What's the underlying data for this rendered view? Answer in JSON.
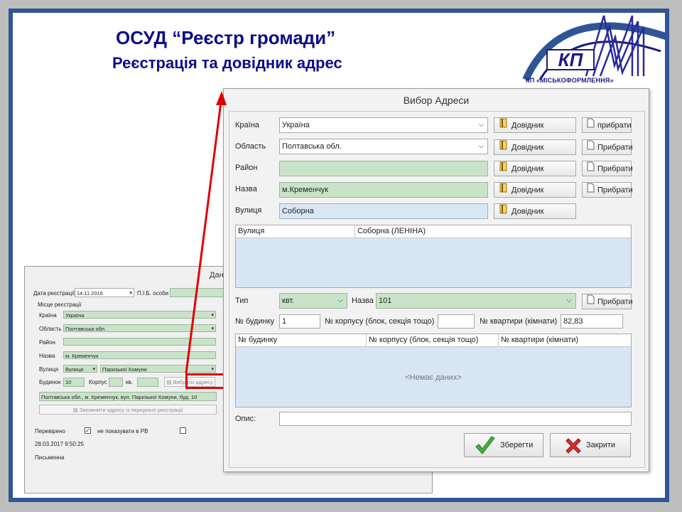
{
  "slide": {
    "title_line1": "ОСУД “Реєстр громади”",
    "title_line2": "Реєстрація та довідник адрес",
    "logo_text": "КП «МІСЬКОФОРМЛЕННЯ»",
    "logo_letters": "КП",
    "frame_color": "#2f5597",
    "title_color": "#0d0d8a",
    "arrow_color": "#e00000"
  },
  "background_form": {
    "title": "Дані",
    "reg_date_label": "Дата реєстрації",
    "reg_date_value": "14.11.2016",
    "pib_label": "П.І.Б. особи",
    "group_label": "Місце реєстрації",
    "country_label": "Країна",
    "country_value": "Україна",
    "region_label": "Область",
    "region_value": "Полтавська обл.",
    "district_label": "Район",
    "district_value": "",
    "name_label": "Назва",
    "name_value": "м. Кременчук",
    "street_label": "Вулиця",
    "street_type": "Вулиця",
    "street_value": "Паризької Комуни",
    "house_label": "Будинок",
    "house_value": "10",
    "korpus_label": "Корпус",
    "kv_label": "кв.",
    "select_address_button": "Вибрати адресу",
    "full_address": "Полтавська обл., м. Кременчук, вул. Паризької Комуни, буд. 10",
    "fill_prev_button": "Заповнити адресу із передньої реєстрації",
    "verified_label": "Перевірено",
    "not_show_label": "не показувати в РВ",
    "timestamp": "28.03.2017 9:50:25",
    "written_label": "Письменна"
  },
  "dialog": {
    "title": "Вибор Адреси",
    "country_label": "Країна",
    "country_value": "Україна",
    "region_label": "Область",
    "region_value": "Полтавська обл.",
    "district_label": "Район",
    "district_value": "",
    "name_label": "Назва",
    "name_value": "м.Кременчук",
    "street_label": "Вулиця",
    "street_value": "Соборна",
    "directory_button": "Довідник",
    "remove_button_lower": "прибрати",
    "remove_button": "Прибрати",
    "street_grid": {
      "columns": [
        "Вулиця",
        "Соборна (ЛЕНІНА)"
      ]
    },
    "type_label": "Тип",
    "type_value": "квт.",
    "type_name_label": "Назва",
    "type_name_value": "101",
    "house_label": "№ будинку",
    "house_value": "1",
    "korpus_label": "№ корпусу (блок, секція тощо)",
    "korpus_value": "",
    "apt_label": "№ квартири (кімнати)",
    "apt_value": "82,83",
    "house_grid": {
      "columns": [
        "№ будинку",
        "№ корпусу (блок, секція тощо)",
        "№ квартири (кімнати)"
      ],
      "empty_text": "<Немає даних>"
    },
    "desc_label": "Опис:",
    "desc_value": "",
    "save_button": "Зберегти",
    "close_button": "Закрити"
  }
}
